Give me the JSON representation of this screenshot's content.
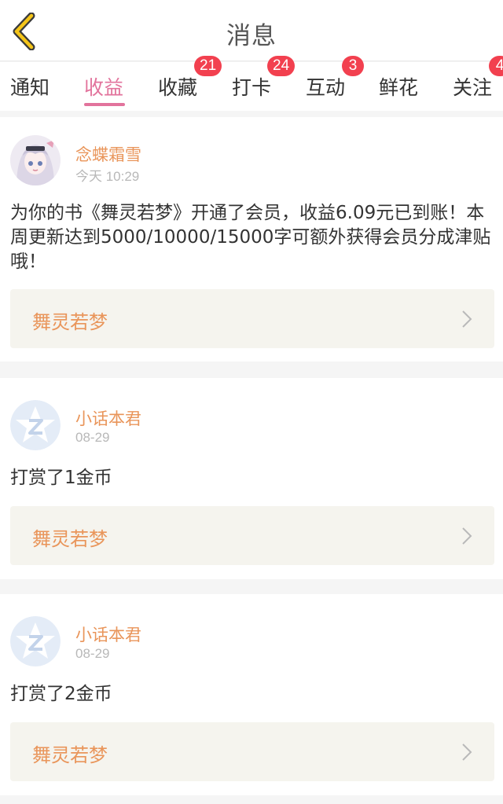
{
  "header": {
    "title": "消息",
    "back_icon": "chevron-left-icon"
  },
  "tabs": [
    {
      "label": "通知",
      "badge": ""
    },
    {
      "label": "收益",
      "badge": ""
    },
    {
      "label": "收藏",
      "badge": "21"
    },
    {
      "label": "打卡",
      "badge": "24"
    },
    {
      "label": "互动",
      "badge": "3"
    },
    {
      "label": "鲜花",
      "badge": ""
    },
    {
      "label": "关注",
      "badge": "4"
    }
  ],
  "active_tab": "收益",
  "colors": {
    "accent": "#e2739c",
    "badge": "#f2404f",
    "author": "#e9955a",
    "book_bg": "#f5f4ee"
  },
  "messages": [
    {
      "author": "念蝶霜雪",
      "time": "今天 10:29",
      "text": "为你的书《舞灵若梦》开通了会员，收益6.09元已到账！本周更新达到5000/10000/15000字可额外获得会员分成津贴哦！",
      "book": "舞灵若梦",
      "avatar": "anime-girl-avatar"
    },
    {
      "author": "小话本君",
      "time": "08-29",
      "text": "打赏了1金币",
      "book": "舞灵若梦",
      "avatar": "default-star-avatar"
    },
    {
      "author": "小话本君",
      "time": "08-29",
      "text": "打赏了2金币",
      "book": "舞灵若梦",
      "avatar": "default-star-avatar"
    }
  ]
}
